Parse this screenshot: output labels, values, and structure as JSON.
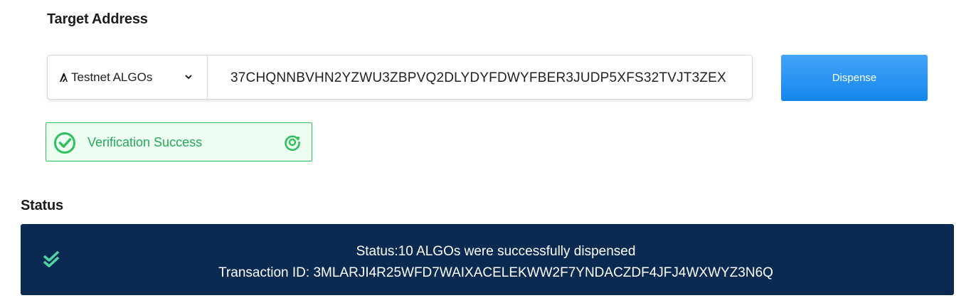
{
  "target": {
    "title": "Target Address",
    "network_select": {
      "icon": "algorand-logo-icon",
      "selected": "Testnet ALGOs"
    },
    "address_value": "37CHQNNBVHN2YZWU3ZBPVQ2DLYDYFDWYFBER3JUDP5XFS32TVJT3ZEX",
    "dispense_label": "Dispense"
  },
  "verification": {
    "label": "Verification Success",
    "icons": [
      "check-circle-icon",
      "refresh-icon"
    ],
    "color": "#25a85a"
  },
  "status": {
    "title": "Status",
    "line1": "Status:10 ALGOs were successfully dispensed",
    "line2": "Transaction ID: 3MLARJI4R25WFD7WAIXACELEKWW2F7YNDACZDF4JFJ4WXWYZ3N6Q",
    "icon": "double-check-icon",
    "background": "#0b2a52"
  },
  "colors": {
    "accent": "#1386ee",
    "success": "#2fbf5e"
  }
}
